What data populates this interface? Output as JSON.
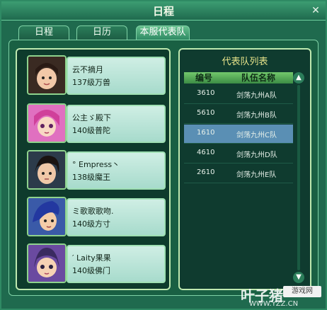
{
  "window": {
    "title": "日程",
    "close_icon": "close-icon"
  },
  "tabs": [
    {
      "label": "日程",
      "active": false
    },
    {
      "label": "日历",
      "active": false
    },
    {
      "label": "本服代表队",
      "active": true
    }
  ],
  "members": [
    {
      "name": "云不摘月",
      "level_class": "137级万兽",
      "avatar_icon": "avatar-boy-smile"
    },
    {
      "name": "公主ゞ殿下",
      "level_class": "140级普陀",
      "avatar_icon": "avatar-pink-hair-girl"
    },
    {
      "name": "° Empress丶",
      "level_class": "138级魔王",
      "avatar_icon": "avatar-dark-hair-boy"
    },
    {
      "name": "ミ歌歌歌吻.",
      "level_class": "140级方寸",
      "avatar_icon": "avatar-blue-hair-boy"
    },
    {
      "name": "′ Laity果果",
      "level_class": "140级佛门",
      "avatar_icon": "avatar-cute-girl"
    }
  ],
  "team_list": {
    "title": "代表队列表",
    "headers": {
      "number": "编号",
      "team_name": "队伍名称"
    },
    "rows": [
      {
        "number": "3610",
        "team_name": "剑荡九州A队",
        "selected": false
      },
      {
        "number": "5610",
        "team_name": "剑荡九州B队",
        "selected": false
      },
      {
        "number": "1610",
        "team_name": "剑荡九州C队",
        "selected": true
      },
      {
        "number": "4610",
        "team_name": "剑荡九州D队",
        "selected": false
      },
      {
        "number": "2610",
        "team_name": "剑荡九州E队",
        "selected": false
      }
    ]
  },
  "watermark": {
    "brand": "叶子猪",
    "badge": "游戏网",
    "url": "WWW.YZZ.CN"
  }
}
